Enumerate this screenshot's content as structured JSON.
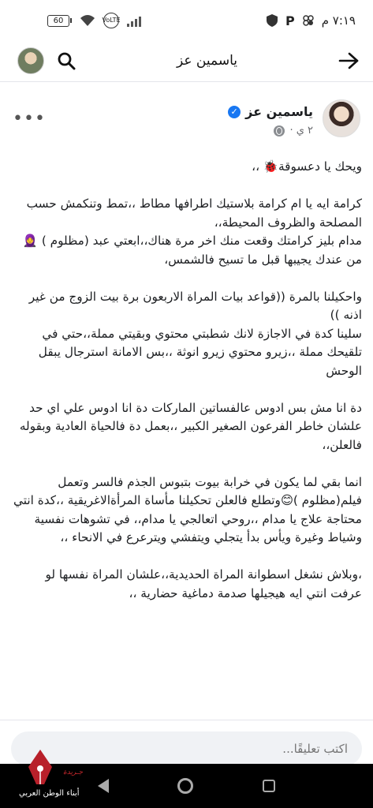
{
  "status_bar": {
    "time": "٧:١٩ م",
    "battery": "60",
    "network": "VoLTE",
    "apps": "P"
  },
  "header": {
    "title": "ياسمين عز"
  },
  "post": {
    "author": "ياسمين عز",
    "time": "٢ ي ·",
    "paragraphs": [
      "ويحك يا دعسوقة🐞 ،،",
      "كرامة ايه يا ام كرامة بلاستيك اطرافها مطاط ،،تمط وتنكمش حسب المصلحة والظروف المحيطة،،\nمدام بليز كرامتك وقعت منك اخر مرة هناك،،ابعتي عبد (مظلوم ) 🧕 من عندك يجيبها قبل ما تسيح فالشمس،",
      "واحكيلنا بالمرة ((قواعد بيات المراة الاربعون برة بيت الزوج من غير اذنه ))\nسلينا كدة في الاجازة لانك شطبتي محتوي وبقيتي مملة،،حتي في تلقيحك مملة ،،زيرو محتوي زيرو انوثة ،،بس الامانة استرجال يبقل الوحش",
      "دة انا مش بس ادوس عالفساتين الماركات  دة انا ادوس علي اي حد علشان خاطر الفرعون الصغير الكبير ،،بعمل دة فالحياة العادية وبقوله فالعلن،،",
      "انما بقي لما يكون في خرابة بيوت بتبوس الجذم فالسر وتعمل فيلم(مظلوم )😊وتطلع فالعلن تحكيلنا مأساة المرأةالاغريقية ،،كدة انتي محتاجة علاج يا مدام ،،روحي اتعالجي يا مدام،، في تشوهات نفسية وشياط وغيرة ويأس بدأ يتجلي ويتفشي ويترعرع في الانحاء ،،",
      "،وبلاش نشغل اسطوانة المراة الحديدية،،علشان  المراة نفسها لو عرفت انتي ايه هيجيلها صدمة دماغية حضارية ،،"
    ]
  },
  "comment": {
    "placeholder": "اكتب تعليقًا..."
  },
  "watermark": {
    "line1": "جـريدة",
    "line2": "أبناء الوطن العربي"
  }
}
